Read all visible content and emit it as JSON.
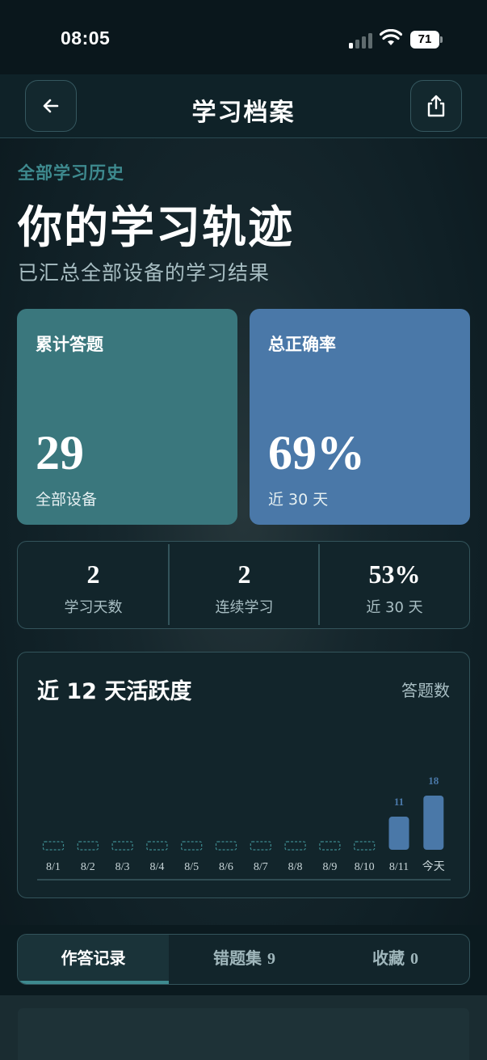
{
  "status_bar": {
    "time": "08:05",
    "battery": "71"
  },
  "nav": {
    "title": "学习档案",
    "back_icon": "arrow-left-icon",
    "share_icon": "share-icon"
  },
  "header": {
    "eyebrow": "全部学习历史",
    "headline": "你的学习轨迹",
    "subline": "已汇总全部设备的学习结果"
  },
  "stat_cards": [
    {
      "label": "累计答题",
      "value": "29",
      "sub": "全部设备",
      "color": "#3a777d"
    },
    {
      "label": "总正确率",
      "value": "69%",
      "sub": "近 30 天",
      "color": "#4a78a8"
    }
  ],
  "mini_stats": [
    {
      "value": "2",
      "label": "学习天数"
    },
    {
      "value": "2",
      "label": "连续学习"
    },
    {
      "value": "53%",
      "label": "近 30 天"
    }
  ],
  "activity": {
    "title": "近 12 天活跃度",
    "unit_label": "答题数"
  },
  "chart_data": {
    "type": "bar",
    "title": "近 12 天活跃度",
    "ylabel": "答题数",
    "categories": [
      "8/1",
      "8/2",
      "8/3",
      "8/4",
      "8/5",
      "8/6",
      "8/7",
      "8/8",
      "8/9",
      "8/10",
      "8/11",
      "今天"
    ],
    "values": [
      0,
      0,
      0,
      0,
      0,
      0,
      0,
      0,
      0,
      0,
      11,
      18
    ],
    "data_labels": [
      "",
      "",
      "",
      "",
      "",
      "",
      "",
      "",
      "",
      "",
      "11",
      "18"
    ],
    "ylim": [
      0,
      18
    ],
    "grid": false,
    "bar_color": "#4a78a8",
    "empty_color": "#3e8a8f"
  },
  "tabs": [
    {
      "label": "作答记录",
      "count": "",
      "active": true
    },
    {
      "label": "错题集",
      "count": "9",
      "active": false
    },
    {
      "label": "收藏",
      "count": "0",
      "active": false
    }
  ]
}
